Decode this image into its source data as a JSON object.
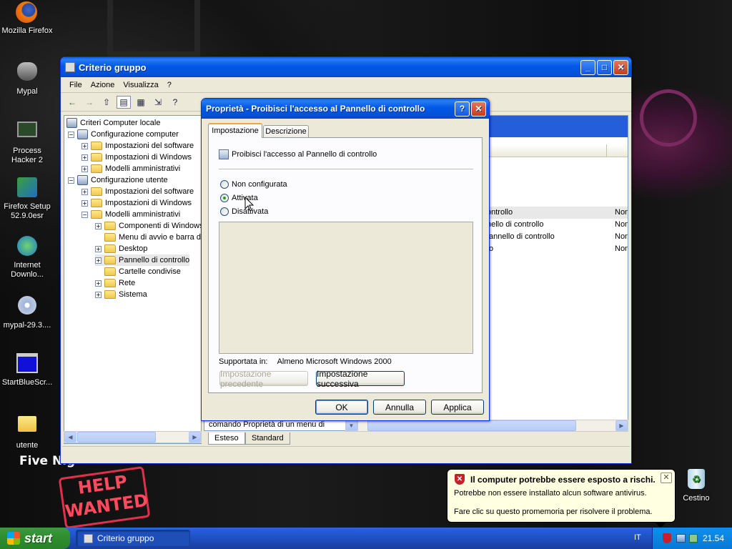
{
  "desktop": {
    "icons": [
      "Mozilla Firefox",
      "Mypal",
      "Process Hacker 2",
      "Firefox Setup 52.9.0esr",
      "Internet Downlo...",
      "mypal-29.3....",
      "StartBlueScr...",
      "utente",
      "Cestino"
    ],
    "bg_text": {
      "fnaf": "Five Nig",
      "help": "HELP",
      "wanted": "WANTED"
    }
  },
  "main_window": {
    "title": "Criterio gruppo",
    "menu": [
      "File",
      "Azione",
      "Visualizza",
      "?"
    ],
    "tree": [
      {
        "label": "Criteri Computer locale",
        "level": 0,
        "sign": ""
      },
      {
        "label": "Configurazione computer",
        "level": 1,
        "sign": "−"
      },
      {
        "label": "Impostazioni del software",
        "level": 2,
        "sign": "+"
      },
      {
        "label": "Impostazioni di Windows",
        "level": 2,
        "sign": "+"
      },
      {
        "label": "Modelli amministrativi",
        "level": 2,
        "sign": "+"
      },
      {
        "label": "Configurazione utente",
        "level": 1,
        "sign": "−"
      },
      {
        "label": "Impostazioni del software",
        "level": 2,
        "sign": "+"
      },
      {
        "label": "Impostazioni di Windows",
        "level": 2,
        "sign": "+"
      },
      {
        "label": "Modelli amministrativi",
        "level": 2,
        "sign": "−"
      },
      {
        "label": "Componenti di Windows",
        "level": 3,
        "sign": "+"
      },
      {
        "label": "Menu di avvio e barra d",
        "level": 3,
        "sign": ""
      },
      {
        "label": "Desktop",
        "level": 3,
        "sign": "+"
      },
      {
        "label": "Pannello di controllo",
        "level": 3,
        "sign": "+"
      },
      {
        "label": "Cartelle condivise",
        "level": 3,
        "sign": ""
      },
      {
        "label": "Rete",
        "level": 3,
        "sign": "+"
      },
      {
        "label": "Sistema",
        "level": 3,
        "sign": "+"
      }
    ],
    "right_rows": [
      {
        "text": "ontrollo",
        "state": "Non"
      },
      {
        "text": "nello di controllo",
        "state": "Non"
      },
      {
        "text": "annello di controllo",
        "state": "Non"
      },
      {
        "text": "o",
        "state": "Non"
      }
    ],
    "bottom_text": "comando Proprietà di un menu di",
    "tabs": [
      "Esteso",
      "Standard"
    ]
  },
  "dialog": {
    "title": "Proprietà - Proibisci l'accesso al Pannello di controllo",
    "tabs": [
      "Impostazione",
      "Descrizione"
    ],
    "setting_name": "Proibisci l'accesso al Pannello di controllo",
    "options": [
      "Non configurata",
      "Attivata",
      "Disattivata"
    ],
    "selected": "Attivata",
    "supported_label": "Supportata in:",
    "supported_value": "Almeno Microsoft Windows 2000",
    "prev_btn": "Impostazione precedente",
    "next_btn": "Impostazione successiva",
    "ok": "OK",
    "cancel": "Annulla",
    "apply": "Applica"
  },
  "balloon": {
    "title": "Il computer potrebbe essere esposto a rischi.",
    "line1": "Potrebbe non essere installato alcun software antivirus.",
    "line2": "Fare clic su questo promemoria per risolvere il problema."
  },
  "taskbar": {
    "start": "start",
    "task": "Criterio gruppo",
    "lang": "IT",
    "clock": "21.54"
  }
}
